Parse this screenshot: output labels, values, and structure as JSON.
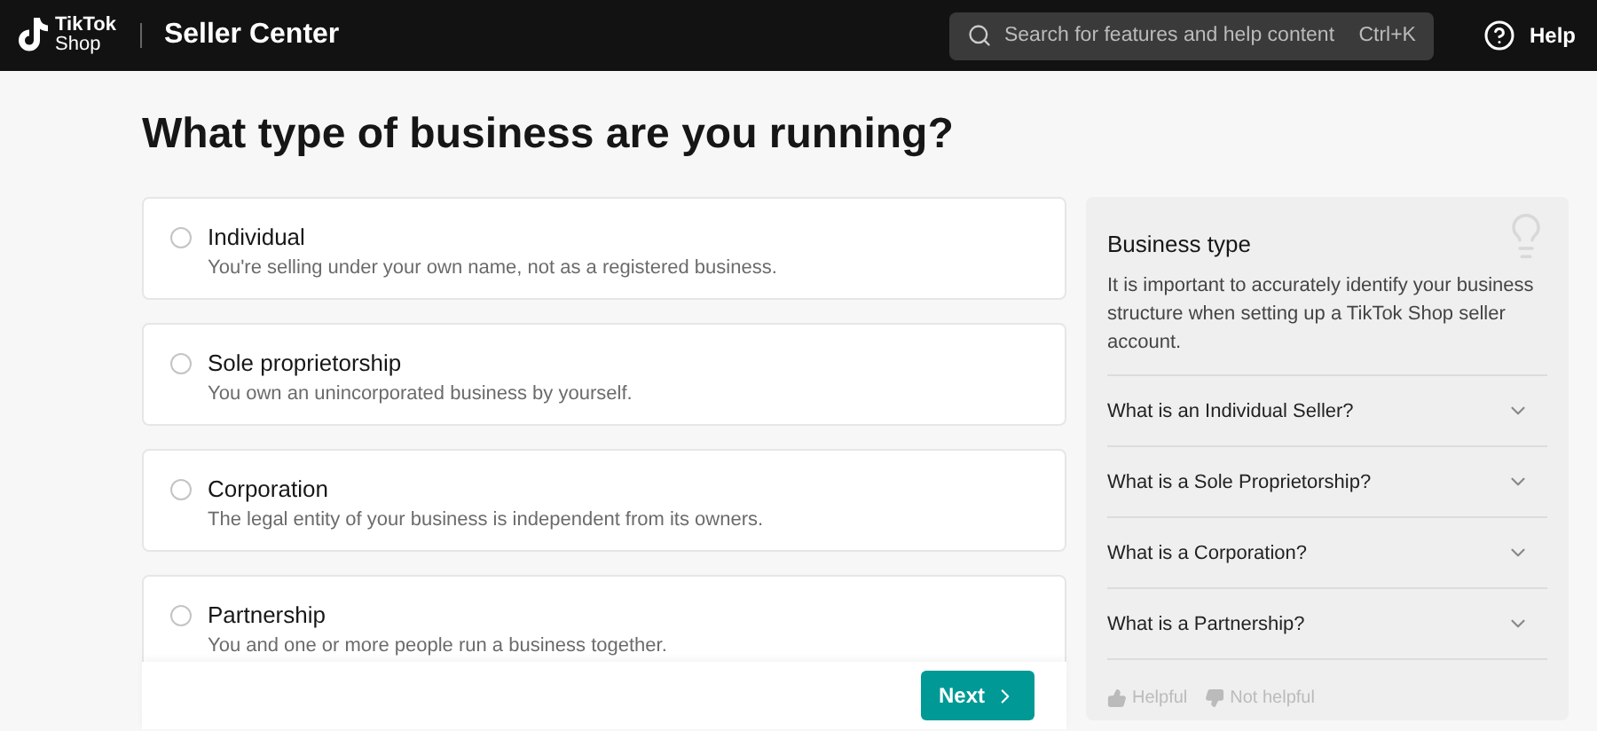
{
  "header": {
    "logo_top": "TikTok",
    "logo_bottom": "Shop",
    "title": "Seller Center",
    "search": {
      "placeholder": "Search for features and help content",
      "shortcut": "Ctrl+K"
    },
    "help": "Help"
  },
  "heading": "What type of business are you running?",
  "options": [
    {
      "label": "Individual",
      "description": "You're selling under your own name, not as a registered business.",
      "selected": false
    },
    {
      "label": "Sole proprietorship",
      "description": "You own an unincorporated business by yourself.",
      "selected": false
    },
    {
      "label": "Corporation",
      "description": "The legal entity of your business is independent from its owners.",
      "selected": false
    },
    {
      "label": "Partnership",
      "description": "You and one or more people run a business together.",
      "selected": false
    }
  ],
  "next_button": "Next",
  "side_panel": {
    "title": "Business type",
    "text": "It is important to accurately identify your business structure when setting up a TikTok Shop seller account.",
    "faqs": [
      {
        "question": "What is an Individual Seller?",
        "expanded": false
      },
      {
        "question": "What is a Sole Proprietorship?",
        "expanded": false
      },
      {
        "question": "What is a Corporation?",
        "expanded": false
      },
      {
        "question": "What is a Partnership?",
        "expanded": false
      }
    ],
    "feedback": [
      "Helpful",
      "Not helpful"
    ]
  }
}
